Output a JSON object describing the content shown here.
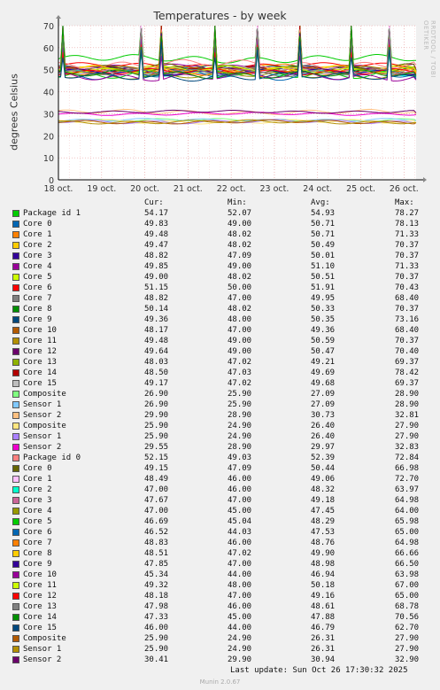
{
  "title": "Temperatures - by week",
  "side_text": "RRDTOOL / TOBI OETIKER",
  "footer": "Last update: Sun Oct 26 17:30:32 2025",
  "munin": "Munin 2.0.67",
  "legend_headers": {
    "cur": "Cur:",
    "min": "Min:",
    "avg": "Avg:",
    "max": "Max:"
  },
  "chart_data": {
    "type": "line",
    "title": "Temperatures - by week",
    "xlabel": "",
    "ylabel": "degrees Celsius",
    "ylim": [
      0,
      70
    ],
    "yticks": [
      "0",
      "10",
      "20",
      "30",
      "40",
      "50",
      "60",
      "70"
    ],
    "x_tick_labels": [
      "18 oct.",
      "19 oct.",
      "20 oct.",
      "21 oct.",
      "22 oct.",
      "23 oct.",
      "24 oct.",
      "25 oct.",
      "26 oct."
    ],
    "grid": true,
    "series": [
      {
        "name": "Package id 1",
        "color": "#00cc00",
        "cur": "54.17",
        "min": "52.07",
        "avg": "54.93",
        "max": "78.27"
      },
      {
        "name": "Core 0",
        "color": "#0066b3",
        "cur": "49.83",
        "min": "49.00",
        "avg": "50.71",
        "max": "78.13"
      },
      {
        "name": "Core 1",
        "color": "#ff8000",
        "cur": "49.48",
        "min": "48.02",
        "avg": "50.71",
        "max": "71.33"
      },
      {
        "name": "Core 2",
        "color": "#ffcc00",
        "cur": "49.47",
        "min": "48.02",
        "avg": "50.49",
        "max": "70.37"
      },
      {
        "name": "Core 3",
        "color": "#330099",
        "cur": "48.82",
        "min": "47.09",
        "avg": "50.01",
        "max": "70.37"
      },
      {
        "name": "Core 4",
        "color": "#990099",
        "cur": "49.85",
        "min": "49.00",
        "avg": "51.10",
        "max": "71.33"
      },
      {
        "name": "Core 5",
        "color": "#ccff00",
        "cur": "49.00",
        "min": "48.02",
        "avg": "50.51",
        "max": "70.37"
      },
      {
        "name": "Core 6",
        "color": "#ff0000",
        "cur": "51.15",
        "min": "50.00",
        "avg": "51.91",
        "max": "70.43"
      },
      {
        "name": "Core 7",
        "color": "#808080",
        "cur": "48.82",
        "min": "47.00",
        "avg": "49.95",
        "max": "68.40"
      },
      {
        "name": "Core 8",
        "color": "#008f00",
        "cur": "50.14",
        "min": "48.02",
        "avg": "50.33",
        "max": "70.37"
      },
      {
        "name": "Core 9",
        "color": "#00487d",
        "cur": "49.36",
        "min": "48.00",
        "avg": "50.35",
        "max": "73.16"
      },
      {
        "name": "Core 10",
        "color": "#b35a00",
        "cur": "48.17",
        "min": "47.00",
        "avg": "49.36",
        "max": "68.40"
      },
      {
        "name": "Core 11",
        "color": "#b38f00",
        "cur": "49.48",
        "min": "49.00",
        "avg": "50.59",
        "max": "70.37"
      },
      {
        "name": "Core 12",
        "color": "#6b006b",
        "cur": "49.64",
        "min": "49.00",
        "avg": "50.47",
        "max": "70.40"
      },
      {
        "name": "Core 13",
        "color": "#8fb300",
        "cur": "48.03",
        "min": "47.02",
        "avg": "49.21",
        "max": "69.37"
      },
      {
        "name": "Core 14",
        "color": "#b30000",
        "cur": "48.50",
        "min": "47.03",
        "avg": "49.69",
        "max": "78.42"
      },
      {
        "name": "Core 15",
        "color": "#bebebe",
        "cur": "49.17",
        "min": "47.02",
        "avg": "49.68",
        "max": "69.37"
      },
      {
        "name": "Composite",
        "color": "#80ff80",
        "cur": "26.90",
        "min": "25.90",
        "avg": "27.09",
        "max": "28.90"
      },
      {
        "name": "Sensor 1",
        "color": "#80c9ff",
        "cur": "26.90",
        "min": "25.90",
        "avg": "27.09",
        "max": "28.90"
      },
      {
        "name": "Sensor 2",
        "color": "#ffc080",
        "cur": "29.90",
        "min": "28.90",
        "avg": "30.73",
        "max": "32.81"
      },
      {
        "name": "Composite",
        "color": "#ffe680",
        "cur": "25.90",
        "min": "24.90",
        "avg": "26.40",
        "max": "27.90"
      },
      {
        "name": "Sensor 1",
        "color": "#aa80ff",
        "cur": "25.90",
        "min": "24.90",
        "avg": "26.40",
        "max": "27.90"
      },
      {
        "name": "Sensor 2",
        "color": "#ee00cc",
        "cur": "29.55",
        "min": "28.90",
        "avg": "29.97",
        "max": "32.83"
      },
      {
        "name": "Package id 0",
        "color": "#ff8080",
        "cur": "52.15",
        "min": "49.03",
        "avg": "52.39",
        "max": "72.84"
      },
      {
        "name": "Core 0",
        "color": "#666600",
        "cur": "49.15",
        "min": "47.09",
        "avg": "50.44",
        "max": "66.98"
      },
      {
        "name": "Core 1",
        "color": "#ffbfff",
        "cur": "48.49",
        "min": "46.00",
        "avg": "49.06",
        "max": "72.70"
      },
      {
        "name": "Core 2",
        "color": "#00ffcc",
        "cur": "47.00",
        "min": "46.00",
        "avg": "48.32",
        "max": "63.97"
      },
      {
        "name": "Core 3",
        "color": "#cc6699",
        "cur": "47.67",
        "min": "47.00",
        "avg": "49.18",
        "max": "64.98"
      },
      {
        "name": "Core 4",
        "color": "#999900",
        "cur": "47.00",
        "min": "45.00",
        "avg": "47.45",
        "max": "64.00"
      },
      {
        "name": "Core 5",
        "color": "#00cc00",
        "cur": "46.69",
        "min": "45.04",
        "avg": "48.29",
        "max": "65.98"
      },
      {
        "name": "Core 6",
        "color": "#0066b3",
        "cur": "46.52",
        "min": "44.03",
        "avg": "47.53",
        "max": "65.00"
      },
      {
        "name": "Core 7",
        "color": "#ff8000",
        "cur": "48.83",
        "min": "46.00",
        "avg": "48.76",
        "max": "64.98"
      },
      {
        "name": "Core 8",
        "color": "#ffcc00",
        "cur": "48.51",
        "min": "47.02",
        "avg": "49.90",
        "max": "66.66"
      },
      {
        "name": "Core 9",
        "color": "#330099",
        "cur": "47.85",
        "min": "47.00",
        "avg": "48.98",
        "max": "66.50"
      },
      {
        "name": "Core 10",
        "color": "#990099",
        "cur": "45.34",
        "min": "44.00",
        "avg": "46.94",
        "max": "63.98"
      },
      {
        "name": "Core 11",
        "color": "#ccff00",
        "cur": "49.32",
        "min": "48.00",
        "avg": "50.18",
        "max": "67.00"
      },
      {
        "name": "Core 12",
        "color": "#ff0000",
        "cur": "48.18",
        "min": "47.00",
        "avg": "49.16",
        "max": "65.00"
      },
      {
        "name": "Core 13",
        "color": "#808080",
        "cur": "47.98",
        "min": "46.00",
        "avg": "48.61",
        "max": "68.78"
      },
      {
        "name": "Core 14",
        "color": "#008f00",
        "cur": "47.33",
        "min": "45.00",
        "avg": "47.88",
        "max": "70.56"
      },
      {
        "name": "Core 15",
        "color": "#00487d",
        "cur": "46.00",
        "min": "44.00",
        "avg": "46.79",
        "max": "62.70"
      },
      {
        "name": "Composite",
        "color": "#b35a00",
        "cur": "25.90",
        "min": "24.90",
        "avg": "26.31",
        "max": "27.90"
      },
      {
        "name": "Sensor 1",
        "color": "#b38f00",
        "cur": "25.90",
        "min": "24.90",
        "avg": "26.31",
        "max": "27.90"
      },
      {
        "name": "Sensor 2",
        "color": "#6b006b",
        "cur": "30.41",
        "min": "29.90",
        "avg": "30.94",
        "max": "32.90"
      }
    ]
  }
}
